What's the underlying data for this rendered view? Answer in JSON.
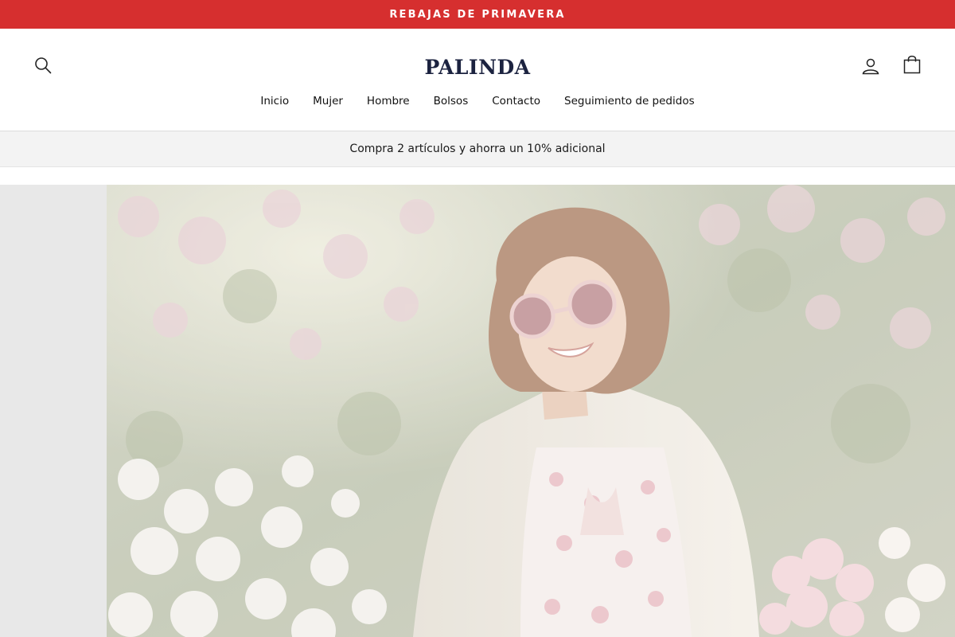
{
  "announcement": {
    "text": "REBAJAS DE PRIMAVERA",
    "background": "#d62f2f"
  },
  "header": {
    "logo": "PALINDA",
    "icons": {
      "search": "search-icon",
      "account": "user-icon",
      "cart": "shopping-bag-icon"
    }
  },
  "nav": {
    "items": [
      {
        "label": "Inicio"
      },
      {
        "label": "Mujer"
      },
      {
        "label": "Hombre"
      },
      {
        "label": "Bolsos"
      },
      {
        "label": "Contacto"
      },
      {
        "label": "Seguimiento de pedidos"
      }
    ]
  },
  "promo": {
    "text": "Compra 2 artículos y ahorra un 10% adicional"
  },
  "colors": {
    "accent": "#d62f2f",
    "logo": "#1c2340",
    "promo_bg": "#f3f3f3"
  }
}
